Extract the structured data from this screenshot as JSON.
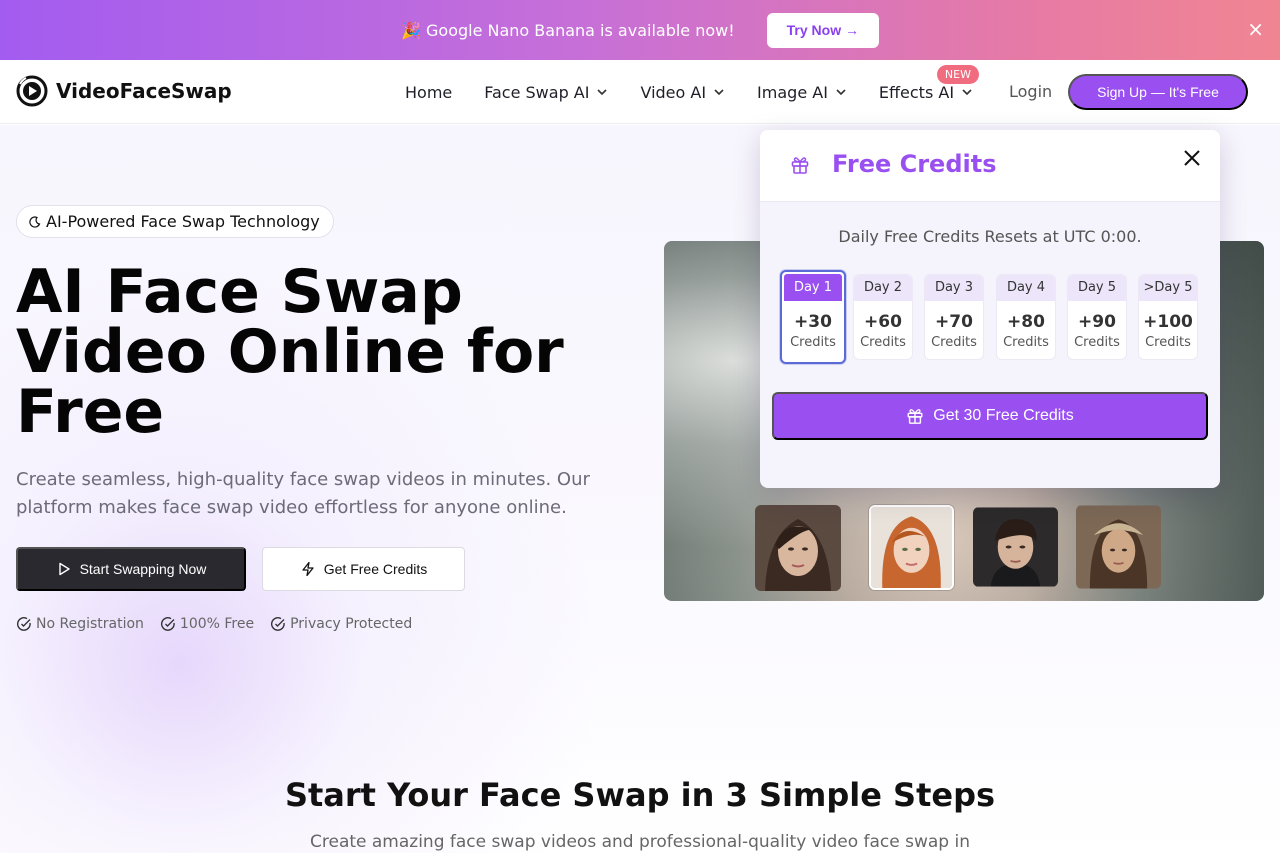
{
  "promo": {
    "emoji": "🎉",
    "text": "Google Nano Banana is available now!",
    "button": "Try Now →",
    "close": "×"
  },
  "nav": {
    "brand": "VideoFaceSwap",
    "items": [
      {
        "label": "Home"
      },
      {
        "label": "Face Swap AI"
      },
      {
        "label": "Video AI"
      },
      {
        "label": "Image AI"
      },
      {
        "label": "Effects AI",
        "badge": "NEW"
      }
    ],
    "login": "Login",
    "signup": "Sign Up — It's Free"
  },
  "hero": {
    "tagline": "AI-Powered Face Swap Technology",
    "title": "AI Face Swap Video Online for Free",
    "description": "Create seamless, high-quality face swap videos in minutes. Our platform makes face swap video effortless for anyone online.",
    "primary_button": "Start Swapping Now",
    "secondary_button": "Get Free Credits",
    "features": [
      "No Registration",
      "100% Free",
      "Privacy Protected"
    ]
  },
  "credits_popup": {
    "title": "Free Credits",
    "subtitle": "Daily Free Credits Resets at UTC 0:00.",
    "days": [
      {
        "label": "Day 1",
        "amount": "+30",
        "unit": "Credits"
      },
      {
        "label": "Day 2",
        "amount": "+60",
        "unit": "Credits"
      },
      {
        "label": "Day 3",
        "amount": "+70",
        "unit": "Credits"
      },
      {
        "label": "Day 4",
        "amount": "+80",
        "unit": "Credits"
      },
      {
        "label": "Day 5",
        "amount": "+90",
        "unit": "Credits"
      },
      {
        "label": ">Day 5",
        "amount": "+100",
        "unit": "Credits"
      }
    ],
    "cta": "Get 30 Free Credits"
  },
  "steps": {
    "title": "Start Your Face Swap in 3 Simple Steps",
    "description": "Create amazing face swap videos and professional-quality video face swap in"
  },
  "colors": {
    "accent": "#9a4ff0",
    "badge": "#ef6d7f",
    "dark_button": "#2a2930"
  }
}
